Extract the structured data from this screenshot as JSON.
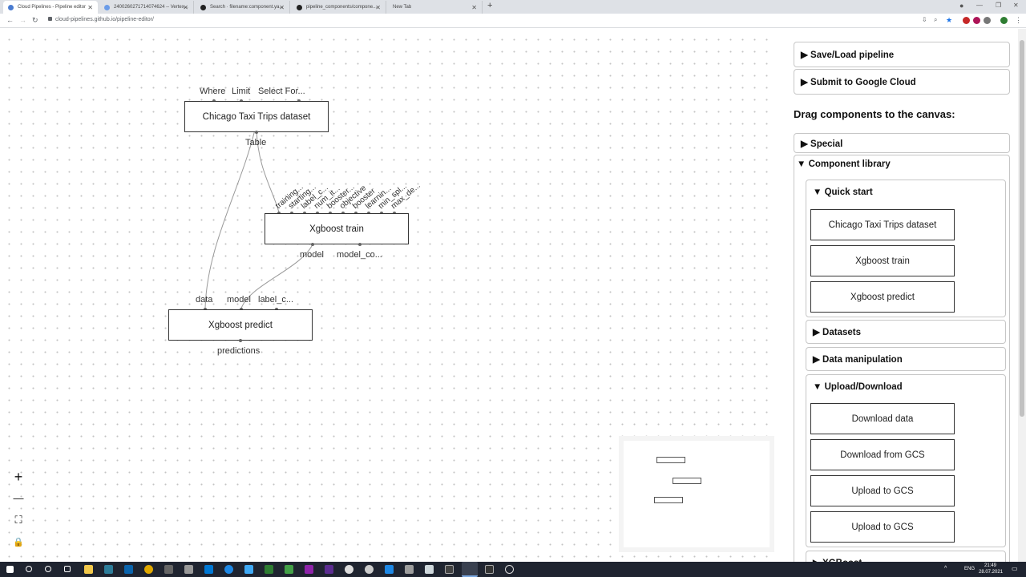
{
  "browser": {
    "tabs": [
      {
        "title": "Cloud Pipelines - Pipeline editor",
        "active": true
      },
      {
        "title": "2400260271714074624 -- Vertex..."
      },
      {
        "title": "Search · filename:component.ya..."
      },
      {
        "title": "pipeline_components/compone..."
      },
      {
        "title": "New Tab"
      }
    ],
    "new_tab": "+",
    "url": "cloud-pipelines.github.io/pipeline-editor/"
  },
  "canvas": {
    "nodes": {
      "chicago": {
        "title": "Chicago Taxi Trips dataset",
        "inputs": [
          "Where",
          "Limit",
          "Select For..."
        ],
        "outputs": [
          "Table"
        ]
      },
      "train": {
        "title": "Xgboost train",
        "inputs": [
          "training...",
          "starting...",
          "label_c...",
          "num_it...",
          "booster...",
          "objective",
          "booster",
          "learnin...",
          "min_spl...",
          "max_de..."
        ],
        "outputs": [
          "model",
          "model_co..."
        ]
      },
      "predict": {
        "title": "Xgboost predict",
        "inputs": [
          "data",
          "model",
          "label_c..."
        ],
        "outputs": [
          "predictions"
        ]
      }
    },
    "zoom_controls": {
      "zoom_in": "+",
      "zoom_out": "—",
      "fit": "⛶",
      "lock": "🔒"
    }
  },
  "panel": {
    "save_load": "▶ Save/Load pipeline",
    "submit": "▶ Submit to Google Cloud",
    "drag_title": "Drag components to the canvas:",
    "special": "▶ Special",
    "component_library": "▼ Component library",
    "quick_start": "▼ Quick start",
    "quick_start_items": [
      "Chicago Taxi Trips dataset",
      "Xgboost train",
      "Xgboost predict"
    ],
    "datasets": "▶ Datasets",
    "data_manipulation": "▶ Data manipulation",
    "upload_download": "▼ Upload/Download",
    "upload_download_items": [
      "Download data",
      "Download from GCS",
      "Upload to GCS",
      "Upload to GCS"
    ],
    "xgboost": "▶ XGBoost"
  },
  "taskbar": {
    "lang": "ENG",
    "time": "21:49",
    "date": "28.07.2021"
  }
}
